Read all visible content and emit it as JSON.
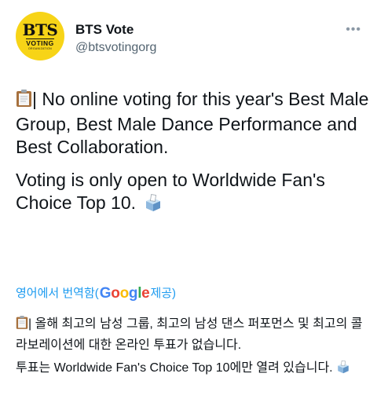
{
  "account": {
    "avatar_main": "BTS",
    "avatar_sub": "VOTING",
    "avatar_org": "ORGANIZATION",
    "name": "BTS Vote",
    "handle": "@btsvotingorg",
    "more_icon": "more-dots-icon"
  },
  "tweet": {
    "paragraph1_prefix": "| No online voting for this year's Best Male Group, Best Male Dance Performance and Best Collaboration.",
    "paragraph2": "Voting is only open to Worldwide Fan's Choice Top 10.",
    "clipboard_icon": "clipboard-icon",
    "ballot_icon": "ballot-box-icon"
  },
  "translation": {
    "label": "영어에서 번역함(",
    "provider": "Google",
    "suffix": " 제공)",
    "paragraph1": "| 올해 최고의 남성 그룹, 최고의 남성 댄스 퍼포먼스 및 최고의 콜라보레이션에 대한 온라인 투표가 없습니다.",
    "paragraph2": "투표는 Worldwide Fan's Choice Top 10에만 열려 있습니다."
  },
  "colors": {
    "link": "#1d9bf0",
    "secondary": "#536471",
    "avatar_bg": "#f7d417",
    "google_blue": "#4285f4",
    "google_red": "#ea4335",
    "google_yellow": "#fbbc05",
    "google_green": "#34a853"
  }
}
